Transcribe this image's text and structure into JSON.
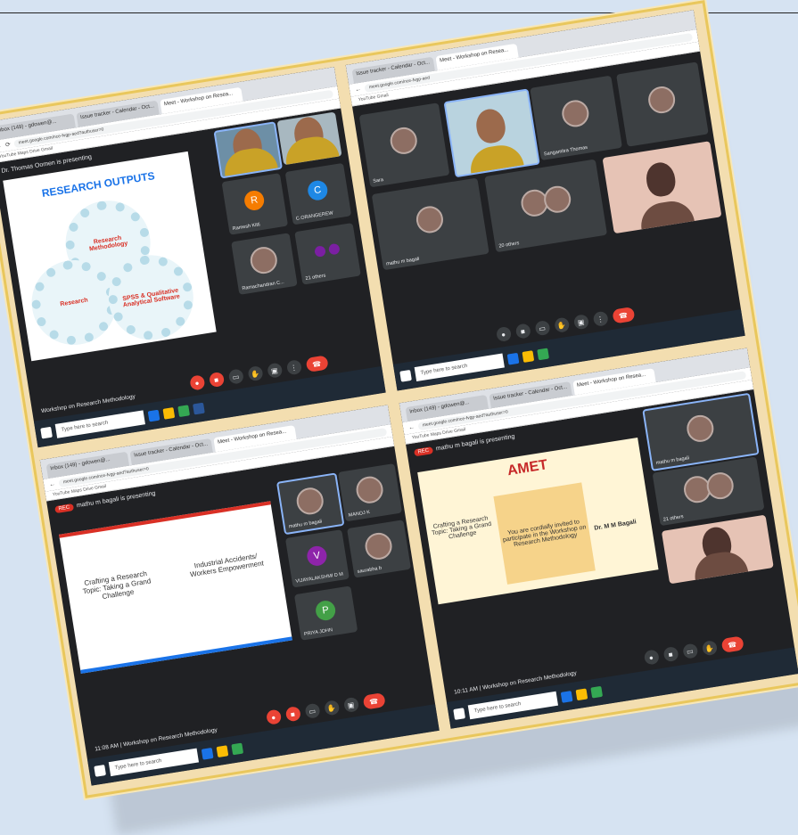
{
  "panels": [
    {
      "tabs": [
        "Inbox (149) - gdowen@...",
        "Issue tracker - Calendar - Oct...",
        "Meet - Workshop on Resea..."
      ],
      "url": "meet.google.com/nce-fvgp-aed?authuser=0",
      "bookmarks": "YouTube   Maps   Drive   Gmail",
      "presenter": "Dr. Thomas Oomen is presenting",
      "slide": {
        "title": "RESEARCH OUTPUTS",
        "gear1": "Research Methodology",
        "gear2": "Research",
        "gear3": "SPSS & Qualitative Analytical Software"
      },
      "tiles": [
        {
          "name": "",
          "kind": "video"
        },
        {
          "name": "",
          "kind": "video"
        },
        {
          "name": "Ramesh Kitti",
          "kind": "avatar",
          "letter": "R",
          "color": "#f57c00"
        },
        {
          "name": "C.ORANGEREW",
          "kind": "avatar",
          "letter": "C",
          "color": "#1e88e5"
        },
        {
          "name": "Ramachandran C...",
          "kind": "face"
        },
        {
          "name": "21 others",
          "kind": "others"
        }
      ],
      "meeting": "Workshop on Research Methodology",
      "search": "Type here to search"
    },
    {
      "tabs": [
        "Issue tracker - Calendar - Oct...",
        "Meet - Workshop on Resea..."
      ],
      "url": "meet.google.com/nce-fvgp-aed",
      "bookmarks": "YouTube   Gmail",
      "tiles": [
        {
          "name": "Sara",
          "kind": "face"
        },
        {
          "name": "",
          "kind": "video"
        },
        {
          "name": "Sangamitra Thomas",
          "kind": "face"
        },
        {
          "name": "",
          "kind": "face"
        },
        {
          "name": "mathu m bagali",
          "kind": "face"
        },
        {
          "name": "20 others",
          "kind": "others"
        },
        {
          "name": "",
          "kind": "video"
        }
      ],
      "search": "Type here to search"
    },
    {
      "tabs": [
        "Inbox (149) - gdowen@...",
        "Issue tracker - Calendar - Oct...",
        "Meet - Workshop on Resea..."
      ],
      "url": "meet.google.com/nce-fvgp-aed?authuser=0",
      "bookmarks": "YouTube   Maps   Drive   Gmail",
      "presenter": "mathu m bagali is presenting",
      "rec": "REC",
      "slide": {
        "left": "Crafting a Research Topic: Taking a Grand Challenge",
        "right": "Industrial Accidents/ Workers Empowerment"
      },
      "tiles": [
        {
          "name": "mathu m bagali",
          "kind": "face"
        },
        {
          "name": "MANOJ K",
          "kind": "face"
        },
        {
          "name": "VIJAYALAKSHMI D M",
          "kind": "avatar",
          "letter": "V",
          "color": "#8e24aa"
        },
        {
          "name": "saurabha b",
          "kind": "face"
        },
        {
          "name": "PRIYA JOHN",
          "kind": "avatar",
          "letter": "P",
          "color": "#43a047"
        }
      ],
      "time": "11:08 AM",
      "meeting": "Workshop on Research Methodology",
      "search": "Type here to search"
    },
    {
      "tabs": [
        "Inbox (149) - gdowen@...",
        "Issue tracker - Calendar - Oct...",
        "Meet - Workshop on Resea..."
      ],
      "url": "meet.google.com/nce-fvgp-aed?authuser=0",
      "bookmarks": "YouTube   Maps   Drive   Gmail",
      "presenter": "mathu m bagali is presenting",
      "rec": "REC",
      "slide": {
        "logo": "AMET",
        "left": "Crafting a Research Topic: Taking a Grand Challenge",
        "invite": "You are cordially invited to participate in the Workshop on Research Methodology",
        "speaker": "Dr. M M Bagali"
      },
      "tiles": [
        {
          "name": "mathu m bagali",
          "kind": "face"
        },
        {
          "name": "21 others",
          "kind": "others"
        },
        {
          "name": "",
          "kind": "video"
        }
      ],
      "time": "10:11 AM",
      "meeting": "Workshop on Research Methodology",
      "search": "Type here to search"
    }
  ]
}
